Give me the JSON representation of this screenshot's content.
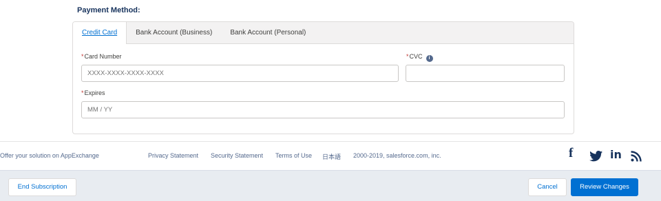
{
  "section": {
    "title": "Payment Method:"
  },
  "tabs": [
    {
      "label": "Credit Card"
    },
    {
      "label": "Bank Account (Business)"
    },
    {
      "label": "Bank Account (Personal)"
    }
  ],
  "form": {
    "required_mark": "*",
    "card_number": {
      "label": "Card Number",
      "placeholder": "XXXX-XXXX-XXXX-XXXX",
      "value": ""
    },
    "cvc": {
      "label": "CVC",
      "info_glyph": "i",
      "value": ""
    },
    "expires": {
      "label": "Expires",
      "placeholder": "MM / YY",
      "value": ""
    }
  },
  "footer": {
    "appexchange": "Offer your solution on AppExchange",
    "privacy": "Privacy Statement",
    "security": "Security Statement",
    "terms": "Terms of Use",
    "language": "日本語",
    "copyright": "2000-2019, salesforce.com, inc.",
    "social": [
      {
        "icon": "facebook-icon",
        "glyph": "f"
      },
      {
        "icon": "twitter-icon",
        "glyph": "🐦"
      },
      {
        "icon": "linkedin-icon",
        "glyph": "in"
      },
      {
        "icon": "rss-icon",
        "glyph": "RSS"
      }
    ]
  },
  "actions": {
    "end_subscription": "End Subscription",
    "cancel": "Cancel",
    "review": "Review Changes"
  },
  "colors": {
    "brand": "#0070d2",
    "action_bar": "#e8ecf1",
    "title": "#16325c"
  }
}
